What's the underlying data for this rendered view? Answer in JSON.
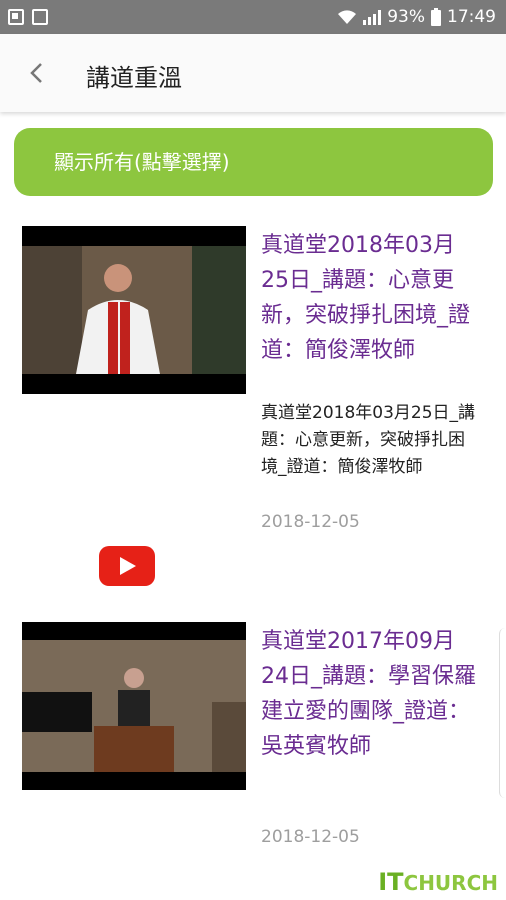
{
  "status_bar": {
    "battery": "93%",
    "time": "17:49"
  },
  "header": {
    "title": "講道重溫"
  },
  "filter_button": {
    "label": "顯示所有(點擊選擇)"
  },
  "videos": [
    {
      "title": "真道堂2018年03月25日_講題：心意更新，突破掙扎困境_證道：簡俊澤牧師",
      "description": "真道堂2018年03月25日_講題：心意更新，突破掙扎困境_證道：簡俊澤牧師",
      "date": "2018-12-05"
    },
    {
      "title": "真道堂2017年09月24日_講題：學習保羅建立愛的團隊_證道：吳英賓牧師",
      "description": "",
      "date": "2018-12-05"
    }
  ],
  "brand": {
    "prefix": "IT",
    "name": "CHURCH"
  }
}
